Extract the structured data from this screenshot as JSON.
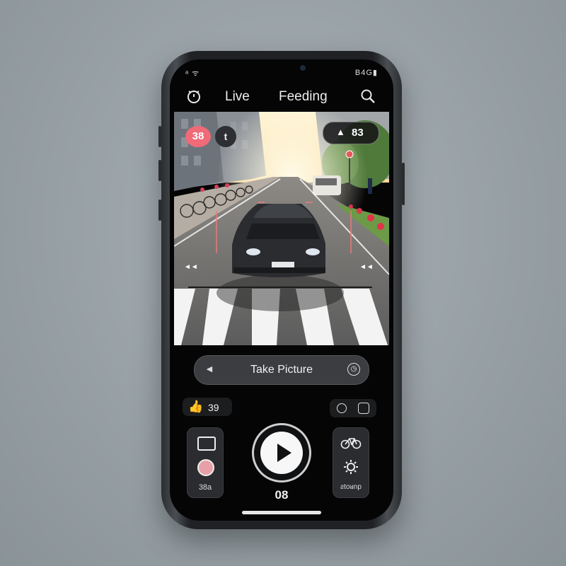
{
  "status_bar": {
    "left_text": "ᵃ ᯤ",
    "right_text": "B4G▮"
  },
  "header": {
    "left_icon": "camera-timer-icon",
    "title_left": "Live",
    "title_right": "Feeding",
    "search_icon": "search-icon"
  },
  "overlay": {
    "record_badge": "38",
    "secondary_badge": "t",
    "alert_pill_text": "83",
    "alert_icon": "person-icon"
  },
  "controls": {
    "take_picture_label": "Take Picture",
    "back_arrow": "◄",
    "timer_icon": "timer-icon",
    "like_icon": "👍",
    "like_count": "39",
    "left_tile_label": "38a",
    "right_tile_label": "ƨtoᴚnp",
    "bottom_count": "08"
  },
  "colors": {
    "accent_red": "#f06a78",
    "screen_bg": "#050506",
    "button_bg": "#3b3d40"
  }
}
